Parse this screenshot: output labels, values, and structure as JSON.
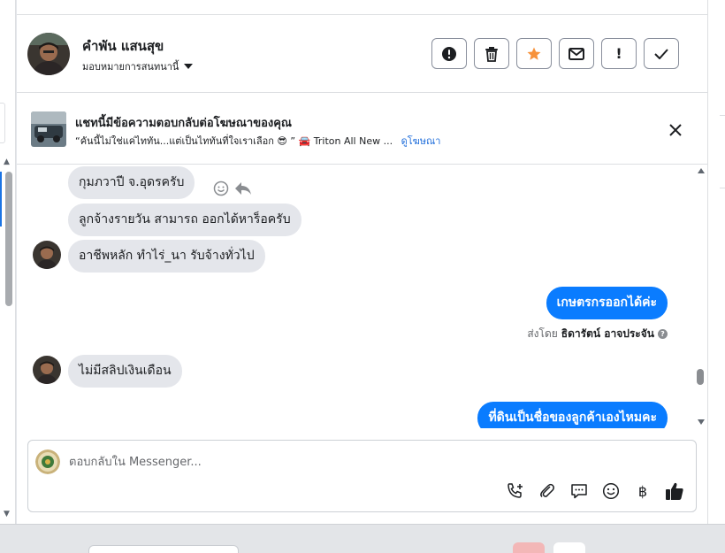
{
  "conversation": {
    "contact_name": "คำพัน แสนสุข",
    "assign_label": "มอบหมายการสนทนานี้"
  },
  "actions": [
    {
      "name": "mark-spam-button",
      "icon": "exclamation-circle-icon"
    },
    {
      "name": "delete-button",
      "icon": "trash-icon"
    },
    {
      "name": "star-button",
      "icon": "star-icon"
    },
    {
      "name": "mark-unread-button",
      "icon": "envelope-icon"
    },
    {
      "name": "follow-up-button",
      "icon": "exclamation-icon",
      "glyph": "!"
    },
    {
      "name": "mark-done-button",
      "icon": "checkmark-icon"
    }
  ],
  "ad": {
    "title": "แชทนี้มีข้อความตอบกลับต่อโฆษณาของคุณ",
    "snippet": "“คันนี้ไม่ใช่แค่ไททัน...แต่เป็นไททันที่ใจเราเลือก 😎 ” 🚘 Triton All New ...",
    "link_label": "ดูโฆษณา"
  },
  "messages": {
    "m1": "กุมภวาปี  จ.อุดรครับ",
    "m2": "ลูกจ้างรายวัน  สามารถ  ออกได้หาร็อครับ",
    "m3": "อาชีพหลัก  ทำไร่_นา  รับจ้างทั่วไป",
    "m4": "เกษตรกรออกได้ค่ะ",
    "m5": "ไม่มีสลิปเงินเดือน",
    "m6": "ที่ดินเป็นชื่อของลูกค้าเองไหมคะ",
    "sent_by_prefix": "ส่งโดย",
    "sent_by_name": "ธิดารัตน์ อาจประจัน",
    "info_glyph": "?"
  },
  "composer": {
    "placeholder": "ตอบกลับใน Messenger...",
    "baht_glyph": "฿"
  },
  "colors": {
    "outgoing_bubble": "#0a7cff",
    "incoming_bubble": "#e4e6eb",
    "star": "#f7923b",
    "link": "#216fdb",
    "like": "#1c1e21"
  }
}
